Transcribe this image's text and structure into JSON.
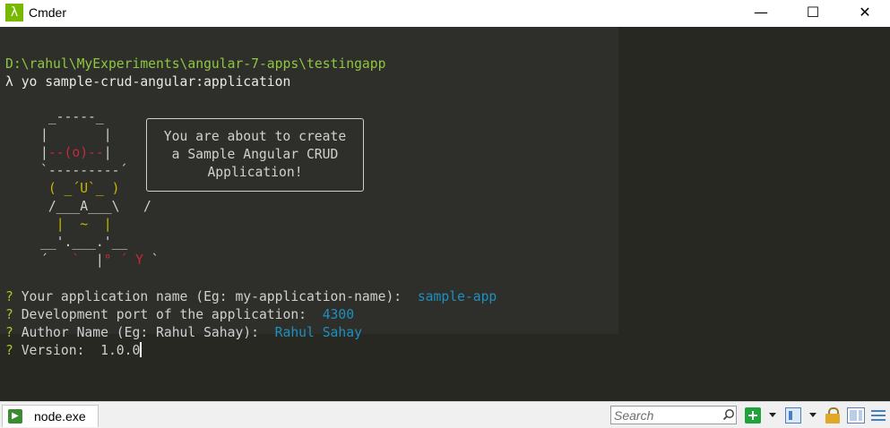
{
  "window": {
    "title": "Cmder",
    "app_icon_glyph": "λ",
    "minimize": "—",
    "maximize": "☐",
    "close": "✕"
  },
  "terminal": {
    "cwd": "D:\\rahul\\MyExperiments\\angular-7-apps\\testingapp",
    "prompt_symbol": "λ",
    "command": "yo sample-crud-angular:application",
    "yeoman_message": [
      "You are about to create",
      "a Sample Angular CRUD",
      "Application!"
    ],
    "questions": [
      {
        "mark": "?",
        "label": "Your application name (Eg: my-application-name):",
        "answer": "sample-app"
      },
      {
        "mark": "?",
        "label": "Development port of the application:",
        "answer": "4300"
      },
      {
        "mark": "?",
        "label": "Author Name (Eg: Rahul Sahay):",
        "answer": "Rahul Sahay"
      },
      {
        "mark": "?",
        "label": "Version:",
        "answer": "1.0.0"
      }
    ]
  },
  "statusbar": {
    "tab_label": "node.exe",
    "tab_icon": "console-icon",
    "search_placeholder": "Search"
  },
  "colors": {
    "terminal_bg": "#272822",
    "path": "#8ec641",
    "answer": "#1f8fbf",
    "question_mark": "#a6c427"
  }
}
